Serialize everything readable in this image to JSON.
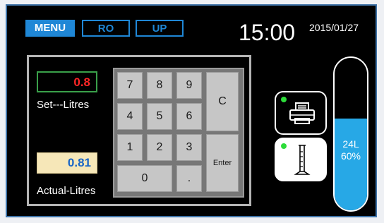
{
  "header": {
    "tabs": [
      {
        "label": "MENU",
        "active": true
      },
      {
        "label": "RO",
        "active": false
      },
      {
        "label": "UP",
        "active": false
      }
    ],
    "time": "15:00",
    "date": "2015/01/27"
  },
  "readouts": {
    "set_value": "0.8",
    "set_label": "Set---Litres",
    "actual_value": "0.81",
    "actual_label": "Actual-Litres"
  },
  "keypad": {
    "keys": [
      "7",
      "8",
      "9",
      "4",
      "5",
      "6",
      "1",
      "2",
      "3",
      "0",
      "."
    ],
    "clear_label": "C",
    "enter_label": "Enter"
  },
  "devices": {
    "printer": {
      "icon": "printer-icon",
      "status_color": "#2ddc3a"
    },
    "cylinder": {
      "icon": "graduated-cylinder-icon",
      "status_color": "#2ddc3a"
    }
  },
  "tank": {
    "volume": "24L",
    "percent": "60%",
    "fill_fraction": 0.6,
    "fill_color": "#27a8e6"
  },
  "colors": {
    "accent": "#1f87d6",
    "set_value": "#ff2626",
    "actual_value": "#1a66c6",
    "actual_bg": "#f6e7b8"
  }
}
